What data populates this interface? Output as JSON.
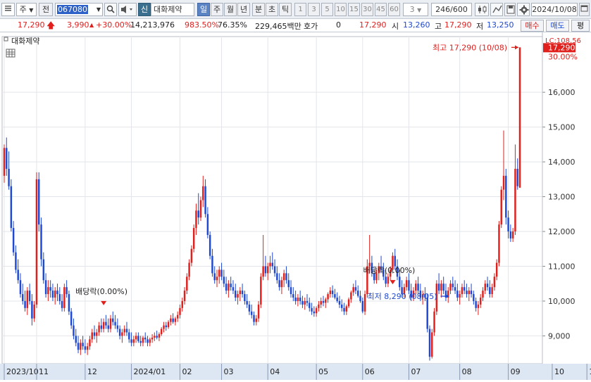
{
  "toolbar": {
    "market": "주",
    "prev": "전",
    "code": "067080",
    "badge": "신",
    "name": "대화제약",
    "periods": [
      "일",
      "주",
      "월",
      "년",
      "분",
      "초",
      "틱"
    ],
    "active_period": "일",
    "intervals": [
      "1",
      "3",
      "5",
      "10",
      "15",
      "30",
      "45",
      "60"
    ],
    "interval_input": "3",
    "count": "246",
    "count_total": "/600",
    "date": "2024/10/08"
  },
  "info": {
    "price": "17,290",
    "change": "3,990",
    "change_pct": "+30.00%",
    "volume": "14,213,976",
    "vol_pct": "983.50%",
    "turnover": "76.35%",
    "amount": "229,465백만",
    "quote_label": "호가",
    "quote": "0",
    "quote_price": "17,290",
    "open_label": "시",
    "open": "13,260",
    "high_label": "고",
    "high": "17,290",
    "low_label": "저",
    "low": "13,250",
    "buy": "매수",
    "sell": "매도",
    "eval": "평"
  },
  "chart_data": {
    "type": "candlestick",
    "series_label": "대화제약",
    "ylim": [
      8200,
      17600
    ],
    "yticks": [
      9000,
      10000,
      11000,
      12000,
      13000,
      14000,
      15000,
      16000
    ],
    "ytick_labels": [
      "9,000",
      "10,000",
      "11,000",
      "12,000",
      "13,000",
      "14,000",
      "15,000",
      "16,000"
    ],
    "xticks": [
      {
        "label": "2023/10",
        "index": 0
      },
      {
        "label": "11",
        "index": 14
      },
      {
        "label": "12",
        "index": 35
      },
      {
        "label": "2024/01",
        "index": 55
      },
      {
        "label": "02",
        "index": 76
      },
      {
        "label": "03",
        "index": 94
      },
      {
        "label": "04",
        "index": 114
      },
      {
        "label": "05",
        "index": 135
      },
      {
        "label": "06",
        "index": 155
      },
      {
        "label": "07",
        "index": 175
      },
      {
        "label": "08",
        "index": 197
      },
      {
        "label": "09",
        "index": 218
      },
      {
        "label": "10",
        "index": 237
      },
      {
        "label": "10/08",
        "index": 252
      }
    ],
    "last_price_label": "17,290",
    "last_pct_label": "30.00%",
    "lc_label": "LC:108.56",
    "annotations": {
      "high": "최고 17,290 (10/08)",
      "low": "최저 8,290 (08/05)",
      "div1": "배당락(0.00%)",
      "div2": "배당락(0.00%)"
    },
    "candles": [
      [
        13600,
        14500,
        13400,
        14400
      ],
      [
        14400,
        14700,
        13600,
        13800
      ],
      [
        13800,
        14300,
        13200,
        13300
      ],
      [
        13300,
        13500,
        12000,
        12100
      ],
      [
        12100,
        12300,
        11300,
        11400
      ],
      [
        11400,
        11600,
        10800,
        10900
      ],
      [
        10900,
        11200,
        10500,
        10600
      ],
      [
        10600,
        10800,
        10100,
        10200
      ],
      [
        10200,
        10500,
        9900,
        10000
      ],
      [
        10000,
        10300,
        9700,
        9800
      ],
      [
        9800,
        10400,
        9600,
        10300
      ],
      [
        10300,
        10500,
        9900,
        10000
      ],
      [
        10000,
        10200,
        9300,
        9500
      ],
      [
        9500,
        10000,
        9400,
        9900
      ],
      [
        9900,
        13700,
        9800,
        13500
      ],
      [
        13500,
        13700,
        12000,
        12200
      ],
      [
        12200,
        12400,
        11000,
        11200
      ],
      [
        11200,
        11400,
        10500,
        10600
      ],
      [
        10600,
        10800,
        10100,
        10200
      ],
      [
        10200,
        10600,
        10000,
        10400
      ],
      [
        10400,
        10600,
        10100,
        10300
      ],
      [
        10300,
        10500,
        10000,
        10100
      ],
      [
        10100,
        10400,
        9900,
        10300
      ],
      [
        10300,
        10500,
        10000,
        10200
      ],
      [
        10200,
        10400,
        9900,
        10000
      ],
      [
        10000,
        10200,
        9700,
        9800
      ],
      [
        9800,
        10500,
        9700,
        10400
      ],
      [
        10400,
        10600,
        10100,
        10200
      ],
      [
        10200,
        10300,
        9600,
        9700
      ],
      [
        9700,
        9800,
        9200,
        9300
      ],
      [
        9300,
        9500,
        8900,
        9000
      ],
      [
        9000,
        9200,
        8700,
        8800
      ],
      [
        8800,
        9000,
        8500,
        8600
      ],
      [
        8600,
        8900,
        8450,
        8800
      ],
      [
        8800,
        9000,
        8600,
        8700
      ],
      [
        8700,
        8900,
        8500,
        8600
      ],
      [
        8600,
        8800,
        8450,
        8700
      ],
      [
        8700,
        9000,
        8600,
        8900
      ],
      [
        8900,
        9200,
        8800,
        9100
      ],
      [
        9100,
        9300,
        8900,
        9000
      ],
      [
        9000,
        9200,
        8800,
        9100
      ],
      [
        9100,
        9400,
        9000,
        9300
      ],
      [
        9300,
        9500,
        9100,
        9200
      ],
      [
        9200,
        9500,
        9100,
        9400
      ],
      [
        9400,
        9600,
        9200,
        9300
      ],
      [
        9300,
        9500,
        9100,
        9200
      ],
      [
        9200,
        9600,
        9100,
        9500
      ],
      [
        9500,
        9700,
        9300,
        9400
      ],
      [
        9400,
        9600,
        9200,
        9300
      ],
      [
        9300,
        9500,
        9100,
        9200
      ],
      [
        9200,
        9300,
        8900,
        9000
      ],
      [
        9000,
        9200,
        8800,
        9100
      ],
      [
        9100,
        9300,
        9000,
        9200
      ],
      [
        9200,
        9400,
        9000,
        9100
      ],
      [
        9100,
        9200,
        8800,
        8900
      ],
      [
        8900,
        9100,
        8700,
        8800
      ],
      [
        8800,
        9000,
        8700,
        8900
      ],
      [
        8900,
        9100,
        8800,
        9000
      ],
      [
        9000,
        9100,
        8800,
        8850
      ],
      [
        8850,
        9000,
        8700,
        8800
      ],
      [
        8800,
        9000,
        8700,
        8950
      ],
      [
        8950,
        9100,
        8800,
        8900
      ],
      [
        8900,
        9000,
        8700,
        8800
      ],
      [
        8800,
        8950,
        8700,
        8900
      ],
      [
        8900,
        9050,
        8800,
        8950
      ],
      [
        8950,
        9100,
        8850,
        9000
      ],
      [
        9000,
        9150,
        8900,
        8950
      ],
      [
        8950,
        9100,
        8850,
        9050
      ],
      [
        9050,
        9250,
        9000,
        9200
      ],
      [
        9200,
        9400,
        9100,
        9300
      ],
      [
        9300,
        9400,
        9150,
        9250
      ],
      [
        9250,
        9450,
        9200,
        9400
      ],
      [
        9400,
        9600,
        9300,
        9500
      ],
      [
        9500,
        9650,
        9350,
        9400
      ],
      [
        9400,
        9550,
        9300,
        9500
      ],
      [
        9500,
        9700,
        9400,
        9600
      ],
      [
        9600,
        9900,
        9500,
        9800
      ],
      [
        9800,
        10100,
        9700,
        10000
      ],
      [
        10000,
        10400,
        9900,
        10300
      ],
      [
        10300,
        10800,
        10200,
        10700
      ],
      [
        10700,
        11200,
        10600,
        11100
      ],
      [
        11100,
        11600,
        11000,
        11500
      ],
      [
        11500,
        12200,
        11400,
        12100
      ],
      [
        12100,
        12800,
        11900,
        12600
      ],
      [
        12600,
        13100,
        12200,
        12400
      ],
      [
        12400,
        13000,
        12300,
        12900
      ],
      [
        12900,
        13600,
        12700,
        13300
      ],
      [
        13300,
        13500,
        12400,
        12500
      ],
      [
        12500,
        12700,
        11800,
        11900
      ],
      [
        11900,
        12000,
        11200,
        11300
      ],
      [
        11300,
        11500,
        10700,
        10800
      ],
      [
        10800,
        11000,
        10500,
        10600
      ],
      [
        10600,
        10900,
        10400,
        10700
      ],
      [
        10700,
        11000,
        10500,
        10900
      ],
      [
        10900,
        11100,
        10600,
        10700
      ],
      [
        10700,
        10900,
        10400,
        10500
      ],
      [
        10500,
        10700,
        10200,
        10300
      ],
      [
        10300,
        10600,
        10100,
        10500
      ],
      [
        10500,
        10700,
        10300,
        10400
      ],
      [
        10400,
        10600,
        10200,
        10300
      ],
      [
        10300,
        10500,
        10000,
        10100
      ],
      [
        10100,
        10300,
        9900,
        10200
      ],
      [
        10200,
        10400,
        10000,
        10300
      ],
      [
        10300,
        10500,
        10100,
        10200
      ],
      [
        10200,
        10300,
        9900,
        10000
      ],
      [
        10000,
        10200,
        9800,
        9900
      ],
      [
        9900,
        10000,
        9600,
        9700
      ],
      [
        9700,
        9900,
        9500,
        9600
      ],
      [
        9600,
        9700,
        9300,
        9400
      ],
      [
        9400,
        9600,
        9300,
        9500
      ],
      [
        9500,
        10000,
        9400,
        9900
      ],
      [
        9900,
        10800,
        9800,
        10700
      ],
      [
        10700,
        11900,
        10600,
        11000
      ],
      [
        11000,
        11300,
        10700,
        10800
      ],
      [
        10800,
        11100,
        10600,
        11000
      ],
      [
        11000,
        11300,
        10800,
        11100
      ],
      [
        11100,
        11400,
        10900,
        11000
      ],
      [
        11000,
        11200,
        10700,
        10800
      ],
      [
        10800,
        11000,
        10500,
        10600
      ],
      [
        10600,
        10800,
        10300,
        10400
      ],
      [
        10400,
        10700,
        10200,
        10600
      ],
      [
        10600,
        10900,
        10400,
        10800
      ],
      [
        10800,
        11000,
        10500,
        10600
      ],
      [
        10600,
        10800,
        10300,
        10400
      ],
      [
        10400,
        10600,
        10100,
        10200
      ],
      [
        10200,
        10400,
        10000,
        10100
      ],
      [
        10100,
        10300,
        9900,
        10000
      ],
      [
        10000,
        10200,
        9850,
        10100
      ],
      [
        10100,
        10300,
        9900,
        10000
      ],
      [
        10000,
        10150,
        9800,
        9900
      ],
      [
        9900,
        10100,
        9750,
        10000
      ],
      [
        10000,
        10200,
        9850,
        9950
      ],
      [
        9950,
        10100,
        9700,
        9800
      ],
      [
        9800,
        9950,
        9600,
        9700
      ],
      [
        9700,
        9850,
        9550,
        9650
      ],
      [
        9650,
        9850,
        9550,
        9800
      ],
      [
        9800,
        10000,
        9700,
        9900
      ],
      [
        9900,
        10100,
        9800,
        10000
      ],
      [
        10000,
        10150,
        9850,
        9950
      ],
      [
        9950,
        10100,
        9800,
        10050
      ],
      [
        10050,
        10250,
        9950,
        10200
      ],
      [
        10200,
        10400,
        10100,
        10300
      ],
      [
        10300,
        10450,
        10100,
        10200
      ],
      [
        10200,
        10350,
        10050,
        10100
      ],
      [
        10100,
        10250,
        9950,
        10000
      ],
      [
        10000,
        10150,
        9800,
        9900
      ],
      [
        9900,
        10050,
        9700,
        9800
      ],
      [
        9800,
        9950,
        9600,
        9700
      ],
      [
        9700,
        9900,
        9600,
        9850
      ],
      [
        9850,
        10100,
        9800,
        10050
      ],
      [
        10050,
        10300,
        9950,
        10250
      ],
      [
        10250,
        10500,
        10150,
        10400
      ],
      [
        10400,
        10600,
        10200,
        10300
      ],
      [
        10300,
        10450,
        10100,
        10150
      ],
      [
        10150,
        10300,
        9950,
        10000
      ],
      [
        10000,
        10100,
        9650,
        9700
      ],
      [
        9700,
        10300,
        9600,
        10200
      ],
      [
        10200,
        11200,
        10100,
        11000
      ],
      [
        11000,
        11900,
        10800,
        11100
      ],
      [
        11100,
        11300,
        10700,
        10800
      ],
      [
        10800,
        11000,
        10500,
        10600
      ],
      [
        10600,
        10900,
        10500,
        10800
      ],
      [
        10800,
        11100,
        10600,
        11000
      ],
      [
        11000,
        11300,
        10800,
        10900
      ],
      [
        10900,
        11100,
        10600,
        10700
      ],
      [
        10700,
        10900,
        10400,
        10500
      ],
      [
        10500,
        10800,
        10400,
        10700
      ],
      [
        10700,
        11000,
        10600,
        10900
      ],
      [
        10900,
        11400,
        10800,
        11300
      ],
      [
        11300,
        11500,
        10900,
        11000
      ],
      [
        11000,
        11200,
        10600,
        10700
      ],
      [
        10700,
        10900,
        10300,
        10400
      ],
      [
        10400,
        10600,
        10100,
        10200
      ],
      [
        10200,
        10500,
        10100,
        10400
      ],
      [
        10400,
        10700,
        10300,
        10600
      ],
      [
        10600,
        10800,
        10200,
        10300
      ],
      [
        10300,
        10500,
        10000,
        10100
      ],
      [
        10100,
        10400,
        10000,
        10300
      ],
      [
        10300,
        10600,
        10200,
        10500
      ],
      [
        10500,
        10700,
        10200,
        10300
      ],
      [
        10300,
        10500,
        10000,
        10100
      ],
      [
        10100,
        10300,
        9900,
        10200
      ],
      [
        10200,
        10400,
        10000,
        10100
      ],
      [
        10100,
        10200,
        9100,
        9200
      ],
      [
        9200,
        9300,
        8290,
        8400
      ],
      [
        8400,
        9200,
        8350,
        9100
      ],
      [
        9100,
        9800,
        9000,
        9700
      ],
      [
        9700,
        10600,
        9600,
        10500
      ],
      [
        10500,
        10800,
        10200,
        10300
      ],
      [
        10300,
        10600,
        10100,
        10500
      ],
      [
        10500,
        10700,
        10200,
        10300
      ],
      [
        10300,
        10500,
        10000,
        10100
      ],
      [
        10100,
        10400,
        9950,
        10300
      ],
      [
        10300,
        10600,
        10200,
        10500
      ],
      [
        10500,
        10700,
        10300,
        10400
      ],
      [
        10400,
        10600,
        10200,
        10300
      ],
      [
        10300,
        10500,
        10000,
        10100
      ],
      [
        10100,
        10300,
        9900,
        10200
      ],
      [
        10200,
        10500,
        10100,
        10400
      ],
      [
        10400,
        10600,
        10200,
        10300
      ],
      [
        10300,
        10500,
        10100,
        10200
      ],
      [
        10200,
        10400,
        10000,
        10300
      ],
      [
        10300,
        10500,
        10100,
        10200
      ],
      [
        10200,
        10300,
        9900,
        10000
      ],
      [
        10000,
        10100,
        9700,
        9800
      ],
      [
        9800,
        10000,
        9600,
        9900
      ],
      [
        9900,
        10200,
        9800,
        10100
      ],
      [
        10100,
        10400,
        10000,
        10300
      ],
      [
        10300,
        10600,
        10200,
        10500
      ],
      [
        10500,
        10700,
        10300,
        10400
      ],
      [
        10400,
        10600,
        10100,
        10200
      ],
      [
        10200,
        10500,
        10100,
        10400
      ],
      [
        10400,
        10800,
        10300,
        10700
      ],
      [
        10700,
        11200,
        10600,
        11100
      ],
      [
        11100,
        12300,
        11000,
        12200
      ],
      [
        12200,
        13300,
        12100,
        13200
      ],
      [
        13200,
        14900,
        12900,
        13600
      ],
      [
        13600,
        13800,
        12200,
        12400
      ],
      [
        12400,
        12600,
        11800,
        12000
      ],
      [
        12000,
        12200,
        11700,
        11800
      ],
      [
        11800,
        12100,
        11700,
        12000
      ],
      [
        12000,
        14500,
        11900,
        13800
      ],
      [
        13800,
        14100,
        13200,
        13300
      ],
      [
        13260,
        17290,
        13250,
        17290
      ]
    ]
  }
}
